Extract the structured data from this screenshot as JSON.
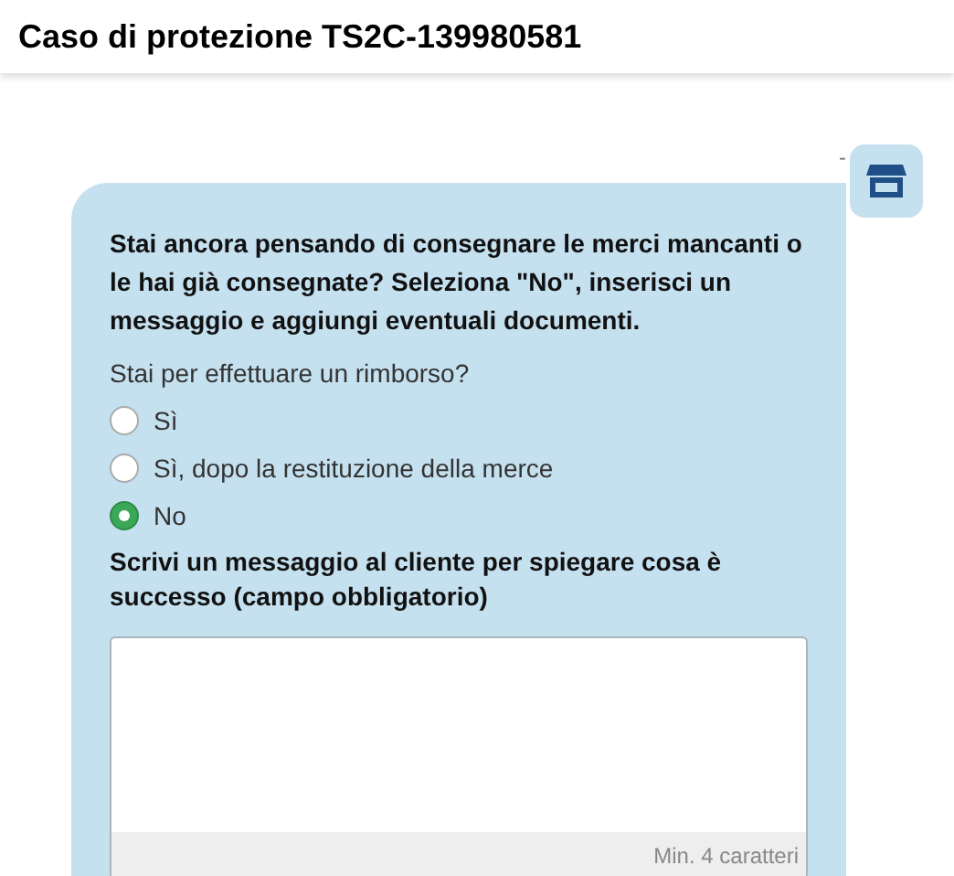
{
  "header": {
    "title": "Caso di protezione TS2C-139980581"
  },
  "message": {
    "sender_mark": "-",
    "intro": "Stai ancora pensando di consegnare le merci mancanti o le hai già consegnate? Seleziona \"No\", inserisci un messaggio e aggiungi eventuali documenti.",
    "question": "Stai per effettuare un rimborso?",
    "options": [
      {
        "label": "Sì",
        "selected": false
      },
      {
        "label": "Sì, dopo la restituzione della merce",
        "selected": false
      },
      {
        "label": "No",
        "selected": true
      }
    ],
    "message_label": "Scrivi un messaggio al cliente per spiegare cosa è successo (campo obbligatorio)",
    "counter_hint": "Min. 4 caratteri"
  }
}
